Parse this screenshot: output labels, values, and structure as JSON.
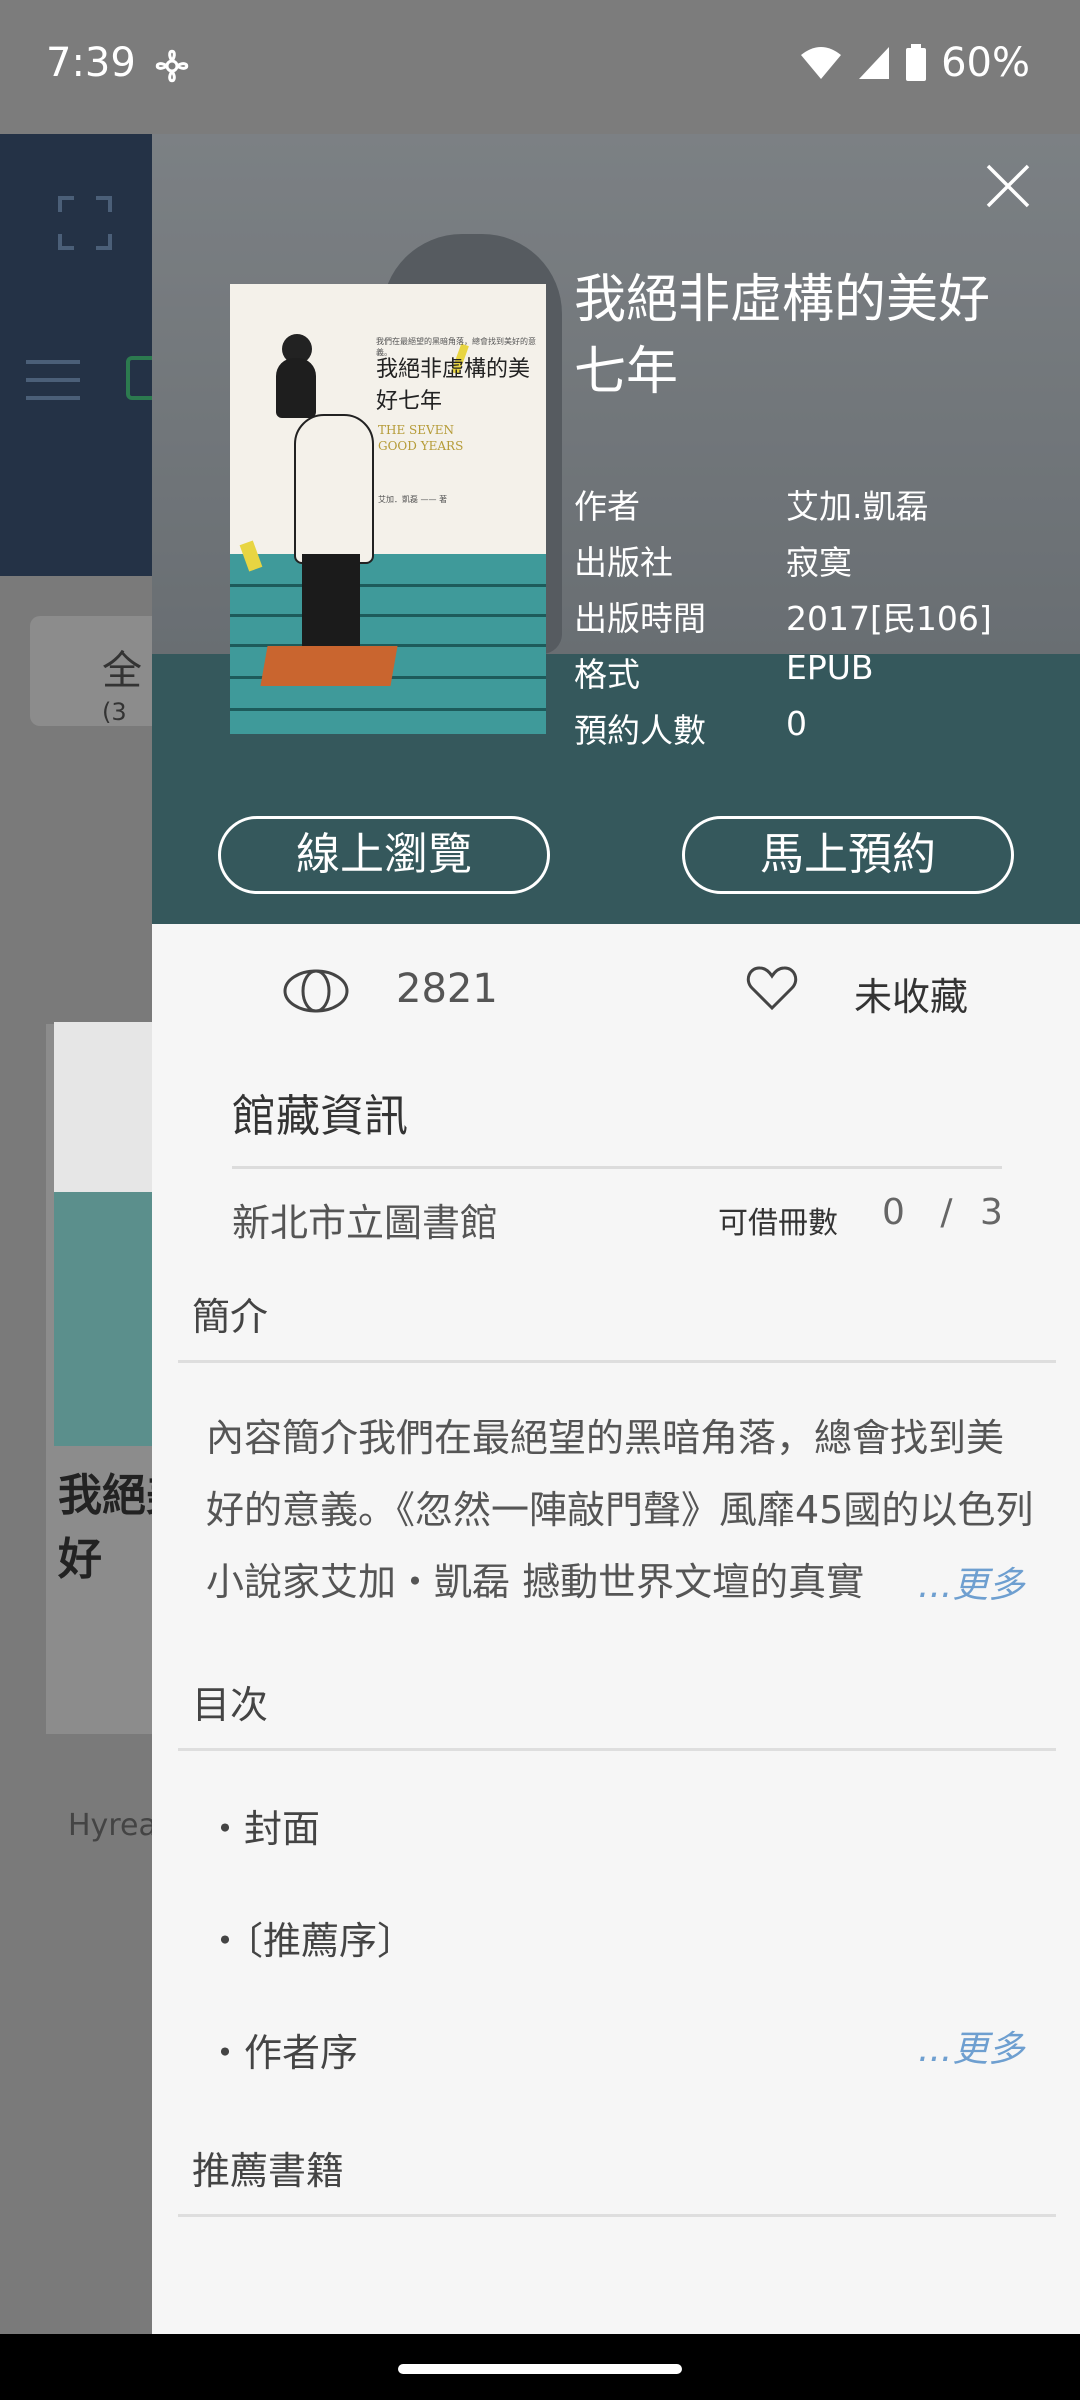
{
  "status_bar": {
    "time": "7:39",
    "battery": "60%"
  },
  "background": {
    "tab_label": "全",
    "tab_count": "(3",
    "book_title_partial": "我絕美好",
    "footer_text": "Hyrea"
  },
  "book": {
    "title": "我絕非虛構的美好七年",
    "cover_text": {
      "tagline": "我們在最絕望的黑暗角落，總會找到美好的意義。",
      "title": "我絕非虛構的美好七年",
      "english_title": "THE SEVEN GOOD YEARS",
      "credits": "艾加．凱磊 —— 著"
    },
    "meta": [
      {
        "label": "作者",
        "value": "艾加.凱磊"
      },
      {
        "label": "出版社",
        "value": "寂寞"
      },
      {
        "label": "出版時間",
        "value": "2017[民106]"
      },
      {
        "label": "格式",
        "value": "EPUB"
      },
      {
        "label": "預約人數",
        "value": "0"
      }
    ],
    "buttons": {
      "browse": "線上瀏覽",
      "reserve": "馬上預約"
    },
    "views": "2821",
    "favorite_label": "未收藏"
  },
  "holdings": {
    "title": "館藏資訊",
    "library": "新北市立圖書館",
    "available_label": "可借冊數",
    "available": "0 /",
    "total": "3"
  },
  "intro": {
    "heading": "簡介",
    "text": "內容簡介我們在最絕望的黑暗角落，總會找到美好的意義。《忽然一陣敲門聲》風靡45國的以色列小說家艾加・凱磊 撼動世界文壇的真實",
    "more": "...更多"
  },
  "toc": {
    "heading": "目次",
    "items": [
      "・封面",
      "・〔推薦序〕",
      "・作者序"
    ],
    "more": "...更多"
  },
  "recommend": {
    "heading": "推薦書籍"
  },
  "colors": {
    "accent_link": "#6e9fd0",
    "header_dark": "#243246",
    "sea": "#3f9a9a"
  },
  "icons": [
    "close-icon",
    "eye-icon",
    "heart-icon",
    "wifi-icon",
    "signal-icon",
    "battery-icon",
    "scan-icon",
    "menu-icon"
  ]
}
